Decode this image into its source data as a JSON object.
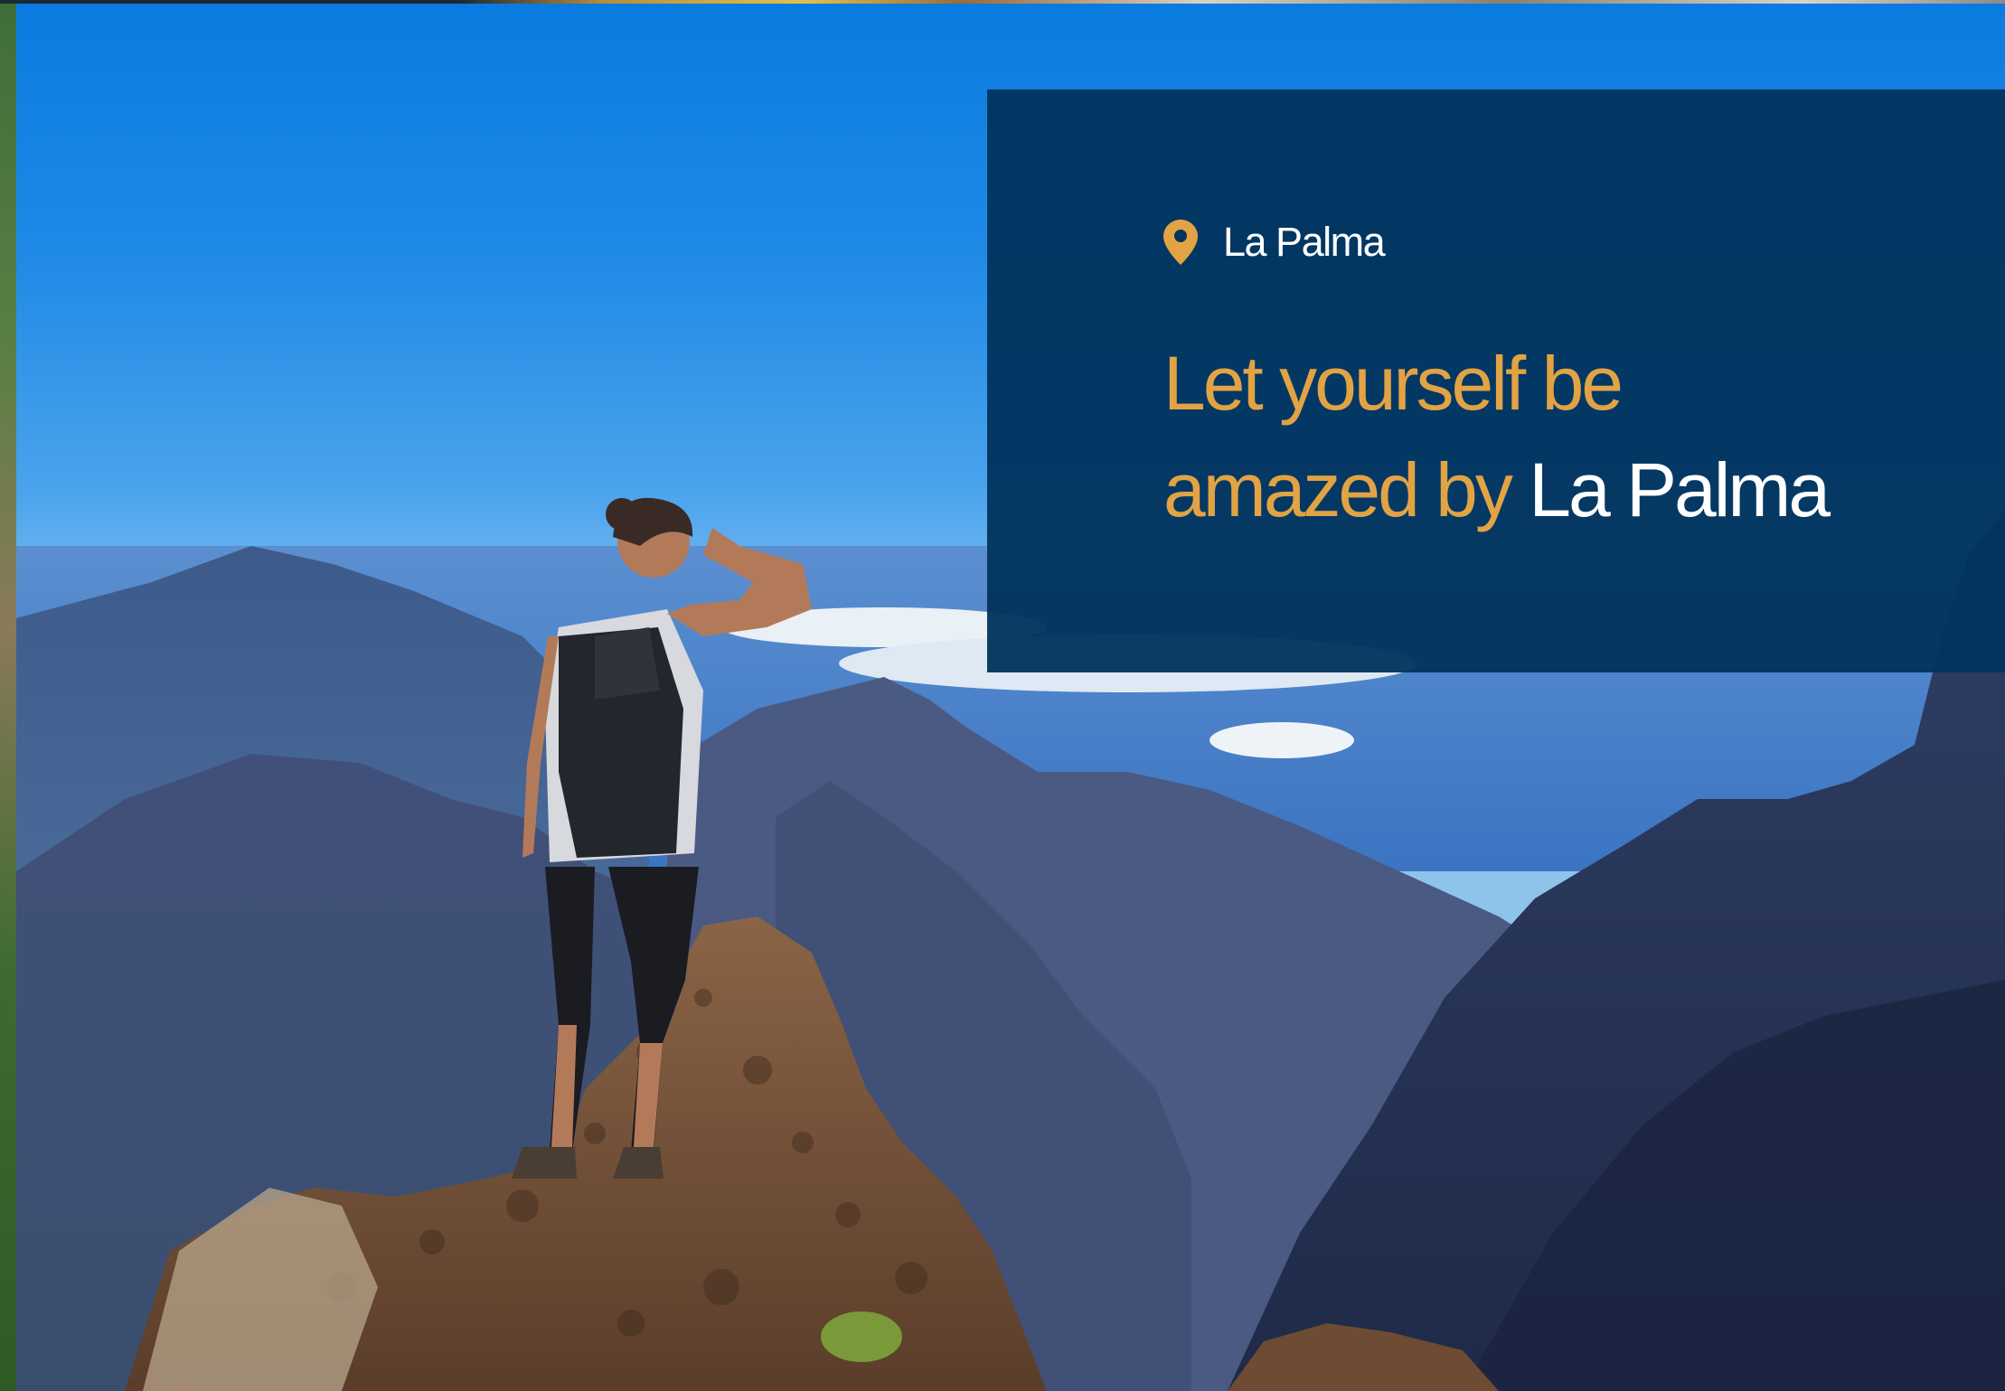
{
  "hero": {
    "image_subject": "hiker-on-mountain-peak-icon"
  },
  "card": {
    "location_icon": "map-pin-icon",
    "location_label": "La Palma",
    "headline_part1": "Let yourself be",
    "headline_part2": "amazed by",
    "headline_accent": "La Palma"
  },
  "colors": {
    "card_background": "#02345e",
    "headline_gold": "#e2a344",
    "pin_gold": "#e2a344",
    "text_white": "#ffffff",
    "sky_blue": "#0a7be0"
  }
}
